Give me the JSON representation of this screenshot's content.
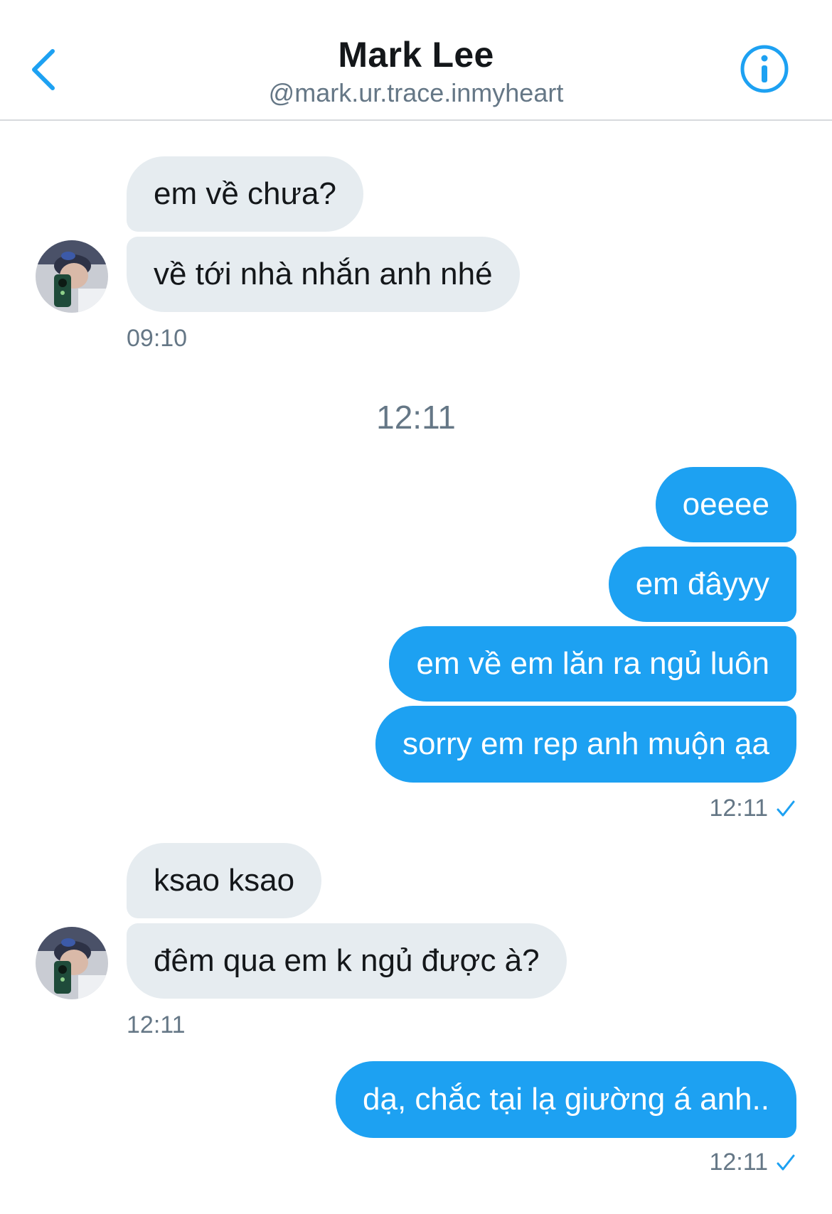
{
  "header": {
    "name": "Mark Lee",
    "handle": "@mark.ur.trace.inmyheart"
  },
  "colors": {
    "accent": "#1da1f2",
    "incoming_bubble": "#e6ecf0",
    "secondary_text": "#657786"
  },
  "messages": {
    "group1": {
      "m1": "em về chưa?",
      "m2": "về tới nhà nhắn anh nhé",
      "time": "09:10"
    },
    "divider_time": "12:11",
    "group2": {
      "m1": "oeeee",
      "m2": "em đâyyy",
      "m3": "em về em lăn ra ngủ luôn",
      "m4": "sorry em rep anh muộn ạa",
      "time": "12:11"
    },
    "group3": {
      "m1": "ksao ksao",
      "m2": "đêm qua em k ngủ được à?",
      "time": "12:11"
    },
    "group4": {
      "m1": "dạ, chắc tại lạ giường á anh..",
      "time": "12:11"
    }
  },
  "icons": {
    "back": "chevron-left-icon",
    "info": "info-icon",
    "read": "checkmark-icon"
  }
}
